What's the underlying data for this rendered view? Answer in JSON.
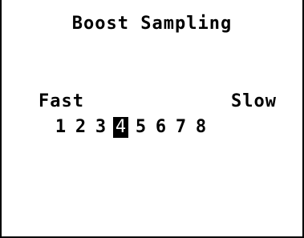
{
  "screen": {
    "title": "Boost Sampling"
  },
  "scale": {
    "left_label": "Fast",
    "right_label": "Slow",
    "steps": [
      "1",
      "2",
      "3",
      "4",
      "5",
      "6",
      "7",
      "8"
    ],
    "selected": "4"
  },
  "colors": {
    "foreground": "#000000",
    "background": "#ffffff",
    "selection_bg": "#000000",
    "selection_fg": "#ffffff"
  }
}
